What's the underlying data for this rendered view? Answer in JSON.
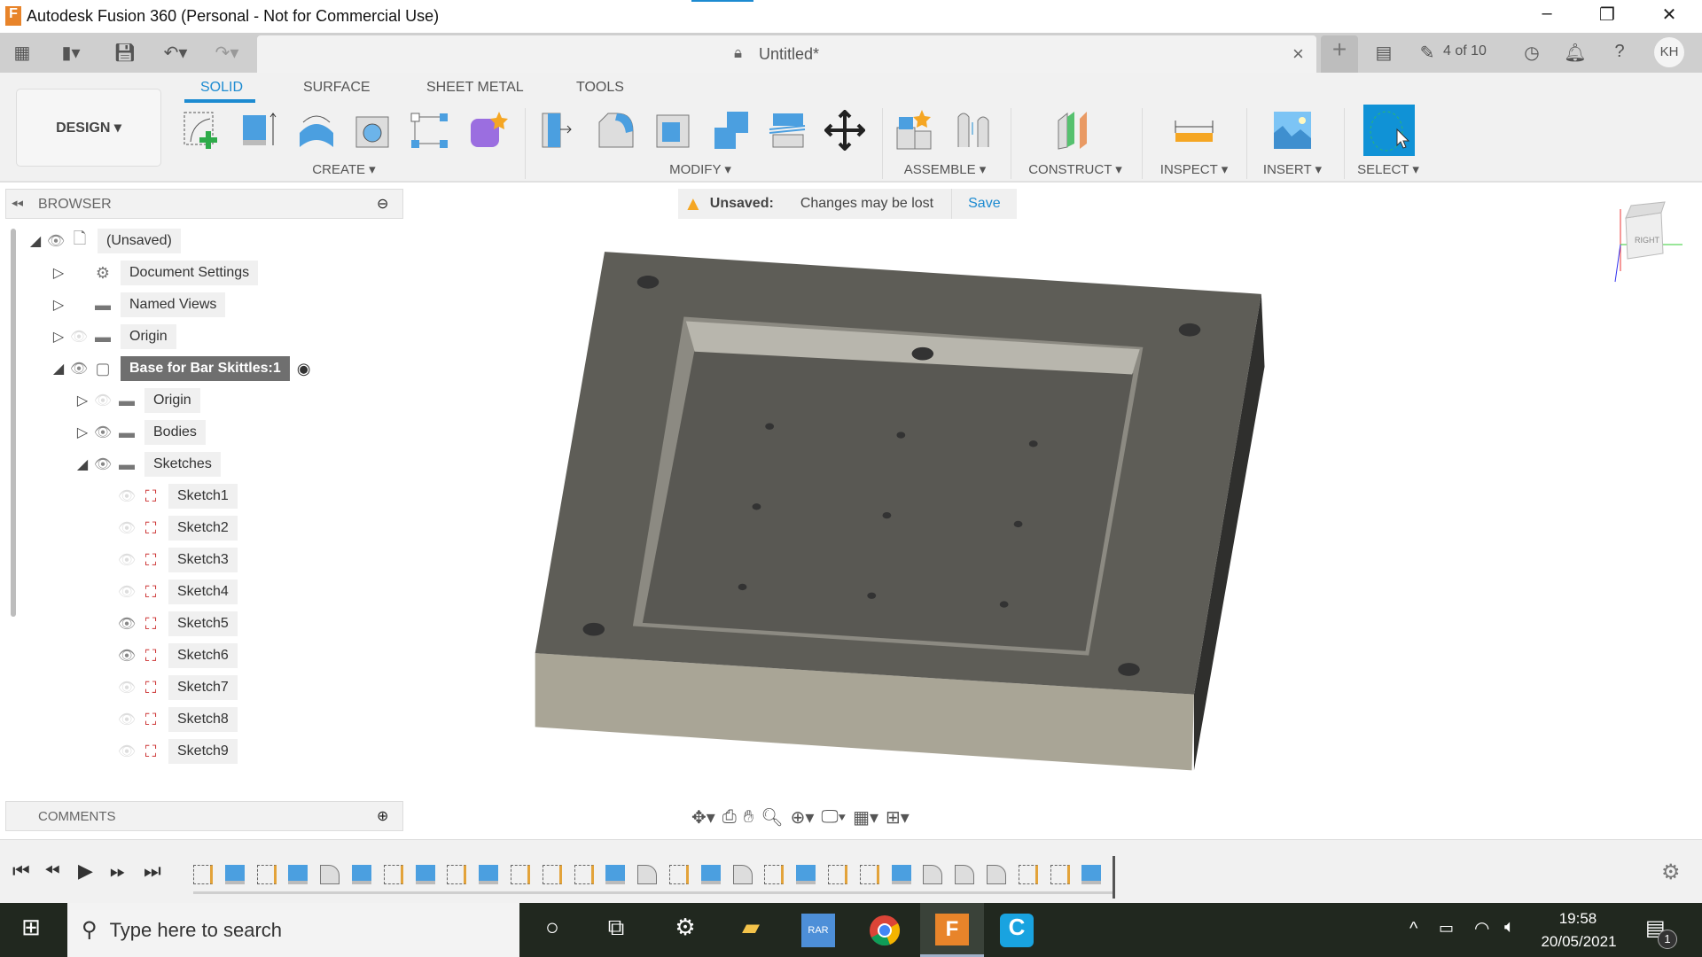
{
  "window": {
    "title": "Autodesk Fusion 360 (Personal - Not for Commercial Use)",
    "minimize": "–",
    "restore": "❐",
    "close": "✕"
  },
  "tabbar": {
    "document_title": "Untitled*",
    "close": "×",
    "new_tab": "+",
    "jobs": "4 of 10",
    "user_initials": "KH"
  },
  "workspace": {
    "label": "DESIGN ▾"
  },
  "ribbon_tabs": [
    {
      "label": "SOLID",
      "active": true
    },
    {
      "label": "SURFACE"
    },
    {
      "label": "SHEET METAL"
    },
    {
      "label": "TOOLS"
    }
  ],
  "ribbon_groups": {
    "create": "CREATE ▾",
    "modify": "MODIFY ▾",
    "assemble": "ASSEMBLE ▾",
    "construct": "CONSTRUCT ▾",
    "inspect": "INSPECT ▾",
    "insert": "INSERT ▾",
    "select": "SELECT ▾"
  },
  "browser": {
    "title": "BROWSER",
    "rows": [
      {
        "label": "(Unsaved)",
        "level": 0,
        "expanded": true,
        "visible": true,
        "icon": "document-icon"
      },
      {
        "label": "Document Settings",
        "level": 1,
        "expanded": false,
        "visible": null,
        "icon": "gear-icon"
      },
      {
        "label": "Named Views",
        "level": 1,
        "expanded": false,
        "visible": null,
        "icon": "folder-icon"
      },
      {
        "label": "Origin",
        "level": 1,
        "expanded": false,
        "visible": false,
        "icon": "folder-icon"
      },
      {
        "label": "Base for Bar Skittles:1",
        "level": 1,
        "expanded": true,
        "visible": true,
        "icon": "component-icon",
        "selected": true
      },
      {
        "label": "Origin",
        "level": 2,
        "expanded": false,
        "visible": false,
        "icon": "folder-icon"
      },
      {
        "label": "Bodies",
        "level": 2,
        "expanded": false,
        "visible": true,
        "icon": "folder-icon"
      },
      {
        "label": "Sketches",
        "level": 2,
        "expanded": true,
        "visible": true,
        "icon": "folder-icon"
      },
      {
        "label": "Sketch1",
        "level": 3,
        "visible": false,
        "icon": "sketch-icon"
      },
      {
        "label": "Sketch2",
        "level": 3,
        "visible": false,
        "icon": "sketch-icon"
      },
      {
        "label": "Sketch3",
        "level": 3,
        "visible": false,
        "icon": "sketch-icon"
      },
      {
        "label": "Sketch4",
        "level": 3,
        "visible": false,
        "icon": "sketch-icon"
      },
      {
        "label": "Sketch5",
        "level": 3,
        "visible": true,
        "icon": "sketch-icon"
      },
      {
        "label": "Sketch6",
        "level": 3,
        "visible": true,
        "icon": "sketch-icon"
      },
      {
        "label": "Sketch7",
        "level": 3,
        "visible": false,
        "icon": "sketch-icon"
      },
      {
        "label": "Sketch8",
        "level": 3,
        "visible": false,
        "icon": "sketch-icon"
      },
      {
        "label": "Sketch9",
        "level": 3,
        "visible": false,
        "icon": "sketch-icon"
      }
    ]
  },
  "banner": {
    "label": "Unsaved:",
    "message": "Changes may be lost",
    "save": "Save"
  },
  "comments": {
    "title": "COMMENTS"
  },
  "viewcube": {
    "label": "RIGHT"
  },
  "timeline": {
    "features": [
      "sketch",
      "extrude",
      "sketch",
      "extrude",
      "fillet",
      "extrude",
      "sketch",
      "extrude",
      "sketch",
      "extrude",
      "sketch",
      "sketch",
      "sketch",
      "extrude",
      "fillet",
      "sketch",
      "extrude",
      "fillet",
      "sketch",
      "extrude",
      "sketch",
      "sketch",
      "extrude",
      "fillet",
      "fillet",
      "fillet",
      "sketch",
      "sketch",
      "extrude"
    ]
  },
  "taskbar": {
    "search_placeholder": "Type here to search",
    "time": "19:58",
    "date": "20/05/2021",
    "notifications": "1"
  },
  "colors": {
    "accent": "#1d8bd1",
    "model_top": "#5e5d57",
    "model_front": "#a9a596",
    "taskbar": "#21281f"
  }
}
